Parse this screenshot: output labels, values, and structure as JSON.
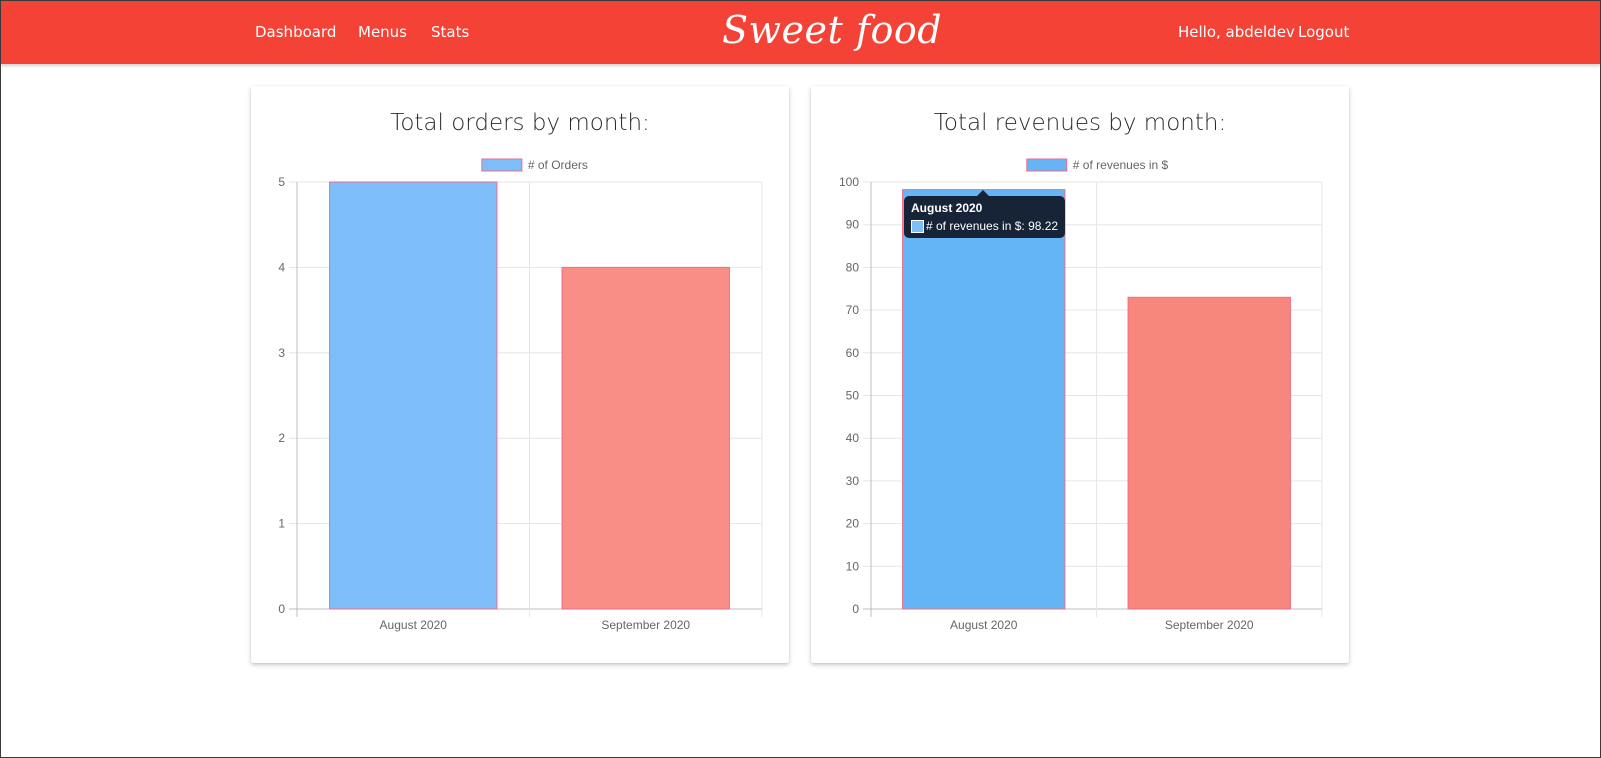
{
  "nav": {
    "links": [
      "Dashboard",
      "Menus",
      "Stats"
    ],
    "brand": "Sweet food",
    "greeting": "Hello, abdeldev",
    "logout": "Logout"
  },
  "colors": {
    "navbar": "#f44336",
    "bar_blue": "#64b5f6",
    "bar_red": "#f7867d",
    "bar_border": "#f26b8a"
  },
  "chart_data": [
    {
      "type": "bar",
      "title": "Total orders by month:",
      "categories": [
        "August 2020",
        "September 2020"
      ],
      "series": [
        {
          "name": "# of Orders",
          "values": [
            5,
            4
          ]
        }
      ],
      "bar_colors": [
        "#7ebef8",
        "#f88e86"
      ],
      "ylim": [
        0,
        5
      ],
      "yticks": [
        0,
        1,
        2,
        3,
        4,
        5
      ],
      "legend": "top-center",
      "grid": true
    },
    {
      "type": "bar",
      "title": "Total revenues by month:",
      "categories": [
        "August 2020",
        "September 2020"
      ],
      "series": [
        {
          "name": "# of revenues in $",
          "values": [
            98.22,
            73
          ]
        }
      ],
      "bar_colors": [
        "#64b5f6",
        "#f7867d"
      ],
      "ylim": [
        0,
        100
      ],
      "yticks": [
        0,
        10,
        20,
        30,
        40,
        50,
        60,
        70,
        80,
        90,
        100
      ],
      "legend": "top-center",
      "grid": true,
      "tooltip": {
        "title": "August 2020",
        "label": "# of revenues in $: 98.22"
      }
    }
  ]
}
